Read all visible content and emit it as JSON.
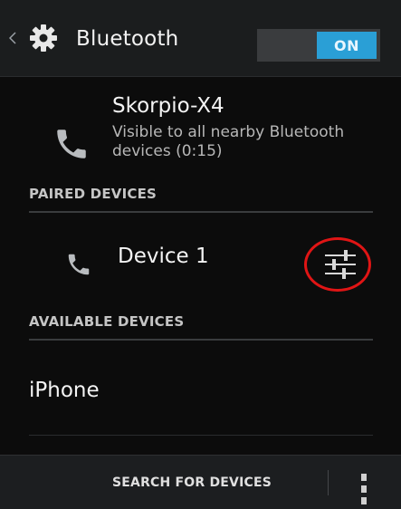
{
  "actionbar": {
    "title": "Bluetooth",
    "toggle_label": "ON"
  },
  "device": {
    "name": "Skorpio-X4",
    "visibility": "Visible to all nearby Bluetooth devices (0:15)"
  },
  "paired": {
    "header": "PAIRED DEVICES",
    "items": [
      {
        "label": "Device 1",
        "icon": "phone-icon"
      }
    ]
  },
  "available": {
    "header": "AVAILABLE DEVICES",
    "items": [
      {
        "label": "iPhone"
      }
    ]
  },
  "bottombar": {
    "search_label": "SEARCH FOR DEVICES"
  },
  "colors": {
    "accent": "#2a9fd6",
    "highlight": "#e01515"
  }
}
